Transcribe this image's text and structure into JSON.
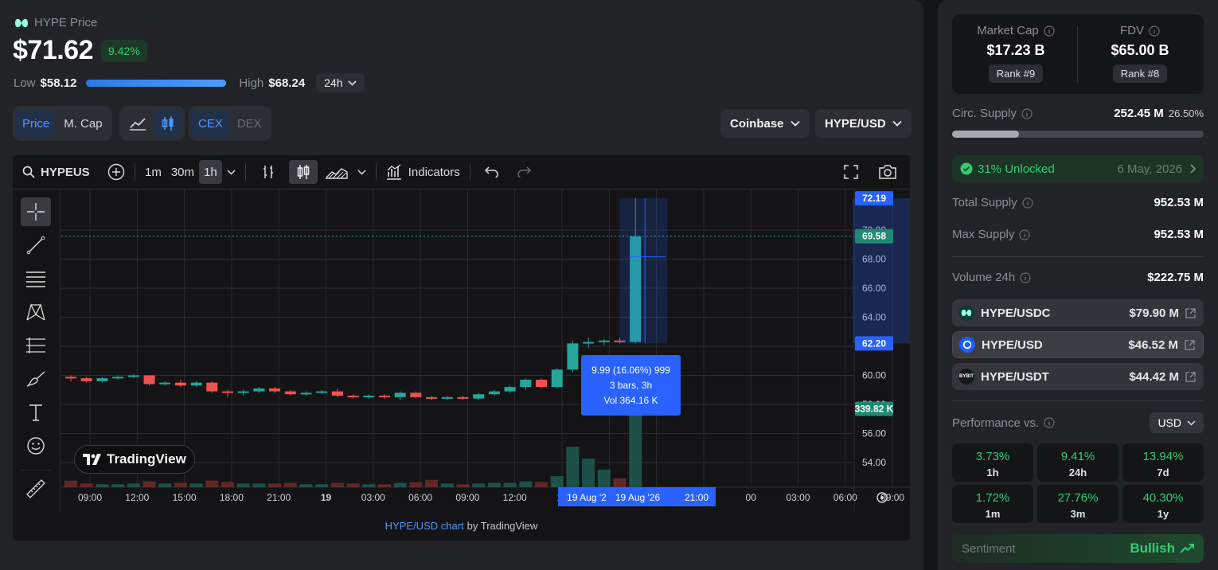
{
  "header": {
    "title": "HYPE Price",
    "price": "$71.62",
    "change": "9.42%",
    "low_label": "Low",
    "low_value": "$58.12",
    "high_label": "High",
    "high_value": "$68.24",
    "range_select": "24h",
    "range_fill": 1.0
  },
  "controls": {
    "price_tab": "Price",
    "mcap_tab": "M. Cap",
    "cex_tab": "CEX",
    "dex_tab": "DEX",
    "exchange": "Coinbase",
    "pair": "HYPE/USD"
  },
  "tv": {
    "symbol": "HYPEUSD",
    "intervals": [
      "1m",
      "30m",
      "1h"
    ],
    "active_interval": "1h",
    "indicators": "Indicators",
    "logo": "TradingView",
    "footer_link": "HYPE/USD chart",
    "footer_by": "by TradingView",
    "tooltip": [
      "9.99 (16.06%) 999",
      "3 bars, 3h",
      "Vol 364.16 K"
    ],
    "price_badges": {
      "top": "72.19",
      "last": "69.58",
      "bottom": "62.20",
      "volume": "339.82 K"
    },
    "x_ticks": [
      "09:00",
      "12:00",
      "15:00",
      "18:00",
      "21:00",
      "19",
      "03:00",
      "06:00",
      "09:00",
      "12:00",
      "15",
      "",
      "",
      "21:00",
      "00",
      "03:00",
      "06:00",
      "09:00"
    ],
    "x_badges": [
      "19 Aug '2",
      "19 Aug '26"
    ]
  },
  "chart_data": {
    "type": "candlestick",
    "interval": "1h",
    "y_ticks": [
      54,
      56,
      58,
      60,
      62,
      64,
      66,
      68,
      70
    ],
    "ylim": [
      52.3,
      72.8
    ],
    "candles": [
      [
        59.9,
        60.0,
        59.6,
        59.8,
        0.9
      ],
      [
        59.8,
        59.9,
        59.5,
        59.6,
        0.5
      ],
      [
        59.6,
        59.9,
        59.5,
        59.8,
        0.4
      ],
      [
        59.8,
        60.0,
        59.7,
        59.9,
        0.4
      ],
      [
        59.9,
        60.1,
        59.8,
        60.0,
        0.5
      ],
      [
        60.0,
        60.0,
        59.3,
        59.4,
        0.8
      ],
      [
        59.4,
        59.6,
        59.3,
        59.5,
        0.5
      ],
      [
        59.5,
        59.7,
        59.2,
        59.3,
        0.6
      ],
      [
        59.3,
        59.6,
        59.2,
        59.5,
        0.5
      ],
      [
        59.5,
        59.6,
        58.8,
        58.9,
        0.9
      ],
      [
        58.9,
        59.0,
        58.5,
        58.8,
        0.7
      ],
      [
        58.8,
        59.0,
        58.6,
        58.9,
        0.5
      ],
      [
        58.9,
        59.2,
        58.8,
        59.1,
        0.5
      ],
      [
        59.1,
        59.2,
        58.8,
        58.9,
        0.5
      ],
      [
        58.9,
        59.0,
        58.6,
        58.7,
        0.6
      ],
      [
        58.7,
        58.9,
        58.6,
        58.8,
        0.4
      ],
      [
        58.8,
        59.0,
        58.7,
        58.9,
        0.4
      ],
      [
        58.9,
        59.1,
        58.5,
        58.6,
        0.6
      ],
      [
        58.6,
        58.7,
        58.4,
        58.5,
        0.5
      ],
      [
        58.5,
        58.7,
        58.4,
        58.6,
        0.4
      ],
      [
        58.6,
        58.7,
        58.4,
        58.5,
        0.4
      ],
      [
        58.5,
        58.9,
        58.3,
        58.8,
        0.6
      ],
      [
        58.8,
        58.9,
        58.4,
        58.5,
        0.7
      ],
      [
        58.5,
        58.6,
        58.3,
        58.4,
        1.0
      ],
      [
        58.4,
        58.6,
        58.3,
        58.5,
        0.5
      ],
      [
        58.5,
        58.6,
        58.3,
        58.4,
        0.4
      ],
      [
        58.4,
        58.8,
        58.3,
        58.7,
        0.5
      ],
      [
        58.7,
        59.0,
        58.6,
        58.9,
        0.6
      ],
      [
        58.9,
        59.3,
        58.8,
        59.2,
        0.6
      ],
      [
        59.2,
        59.8,
        59.0,
        59.7,
        0.8
      ],
      [
        59.7,
        59.8,
        59.1,
        59.2,
        0.7
      ],
      [
        59.2,
        60.5,
        59.1,
        60.4,
        1.5
      ],
      [
        60.4,
        62.4,
        60.2,
        62.2,
        5.5
      ],
      [
        62.2,
        62.6,
        61.9,
        62.3,
        3.9
      ],
      [
        62.3,
        62.5,
        62.1,
        62.4,
        2.4
      ],
      [
        62.4,
        62.6,
        62.2,
        62.3,
        1.2
      ],
      [
        62.3,
        72.2,
        62.2,
        69.58,
        13.0
      ]
    ],
    "volume_unit": "relative"
  },
  "market": {
    "mcap_label": "Market Cap",
    "mcap_value": "$17.23 B",
    "mcap_rank": "Rank #9",
    "fdv_label": "FDV",
    "fdv_value": "$65.00 B",
    "fdv_rank": "Rank #8",
    "circ_label": "Circ. Supply",
    "circ_value": "252.45 M",
    "circ_pct": "26.50%",
    "circ_fill": 0.265,
    "unlocked_label": "31% Unlocked",
    "unlocked_date": "6 May, 2026",
    "total_label": "Total Supply",
    "total_value": "952.53 M",
    "max_label": "Max Supply",
    "max_value": "952.53 M",
    "vol_label": "Volume 24h",
    "vol_value": "$222.75 M",
    "pairs": [
      {
        "name": "HYPE/USDC",
        "value": "$79.90 M"
      },
      {
        "name": "HYPE/USD",
        "value": "$46.52 M"
      },
      {
        "name": "HYPE/USDT",
        "value": "$44.42 M"
      }
    ],
    "bybit_text": "BYBIT"
  },
  "performance": {
    "label": "Performance vs.",
    "currency": "USD",
    "cells": [
      {
        "v": "3.73%",
        "l": "1h"
      },
      {
        "v": "9.41%",
        "l": "24h"
      },
      {
        "v": "13.94%",
        "l": "7d"
      },
      {
        "v": "1.72%",
        "l": "1m"
      },
      {
        "v": "27.76%",
        "l": "3m"
      },
      {
        "v": "40.30%",
        "l": "1y"
      }
    ],
    "sentiment_label": "Sentiment",
    "sentiment_value": "Bullish"
  },
  "colors": {
    "up": "#26a69a",
    "down": "#ef5350",
    "accent": "#2962ff",
    "green": "#2fcf71"
  }
}
